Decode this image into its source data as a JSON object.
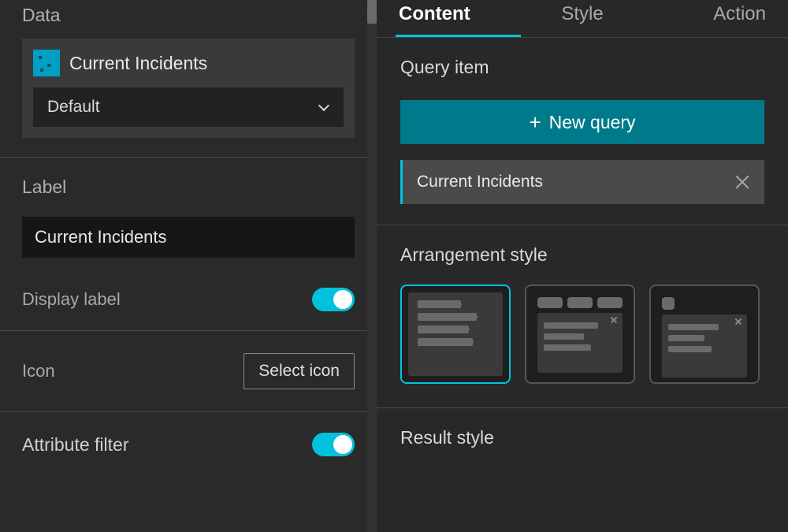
{
  "left": {
    "data_heading": "Data",
    "layer_name": "Current Incidents",
    "view_select": "Default",
    "label_heading": "Label",
    "label_value": "Current Incidents",
    "display_label": "Display label",
    "icon_label": "Icon",
    "select_icon_btn": "Select icon",
    "attribute_filter": "Attribute filter"
  },
  "right": {
    "tabs": {
      "content": "Content",
      "style": "Style",
      "action": "Action"
    },
    "query_item_heading": "Query item",
    "new_query_btn": "New query",
    "query_name": "Current Incidents",
    "arrangement_heading": "Arrangement style",
    "result_heading": "Result style"
  }
}
